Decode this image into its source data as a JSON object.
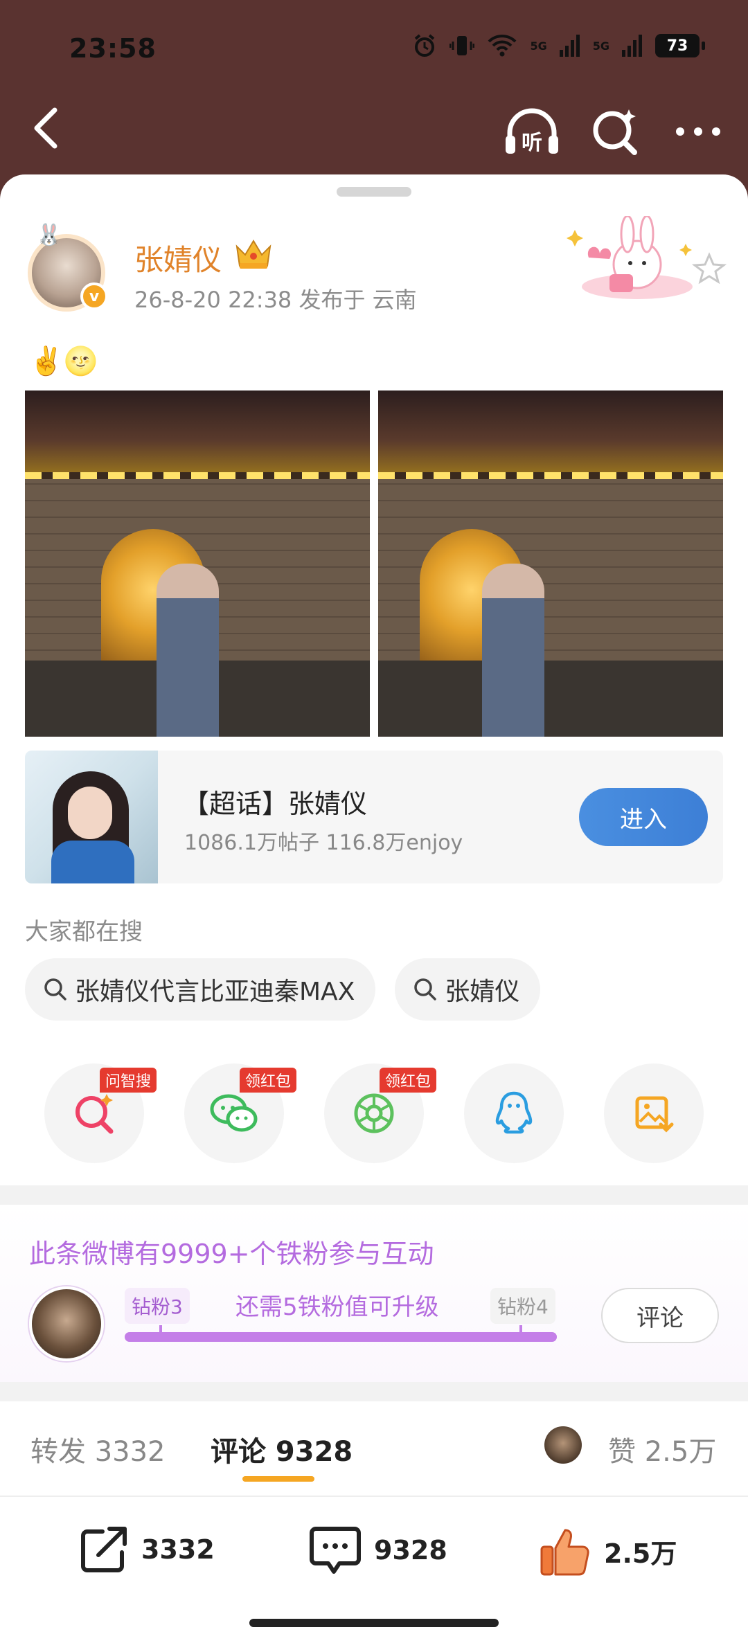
{
  "status_bar": {
    "time": "23:58",
    "signal1_label": "5G",
    "signal2_label": "5G",
    "battery": "73",
    "icons": [
      "alarm-icon",
      "vibrate-icon",
      "wifi-icon",
      "signal-icon",
      "signal-icon",
      "battery-icon"
    ]
  },
  "nav": {
    "back_icon": "chevron-left-icon",
    "listen_label": "听",
    "search_icon": "ai-search-icon",
    "more_icon": "more-icon"
  },
  "post": {
    "author": "张婧仪",
    "meta": "26-8-20 22:38   发布于 云南",
    "avatar_badge": "v",
    "emoji": "✌️🌝",
    "photos_count": 2
  },
  "super_topic": {
    "title": "【超话】张婧仪",
    "stats": "1086.1万帖子 116.8万enjoy",
    "enter_label": "进入"
  },
  "search": {
    "label": "大家都在搜",
    "chips": [
      "张婧仪代言比亚迪秦MAX",
      "张婧仪"
    ]
  },
  "share": {
    "items": [
      {
        "name": "ai-search",
        "tag": "问智搜",
        "icon": "ai-search-icon"
      },
      {
        "name": "wechat",
        "tag": "领红包",
        "icon": "wechat-icon"
      },
      {
        "name": "moments",
        "tag": "领红包",
        "icon": "moments-icon"
      },
      {
        "name": "qq",
        "tag": "",
        "icon": "qq-icon"
      },
      {
        "name": "save-image",
        "tag": "",
        "icon": "save-image-icon"
      }
    ]
  },
  "fans": {
    "title": "此条微博有9999+个铁粉参与互动",
    "level_from": "钻粉3",
    "level_hint": "还需5铁粉值可升级",
    "level_to": "钻粉4",
    "progress": 0.07,
    "comment_label": "评论"
  },
  "tabs": {
    "repost": "转发 3332",
    "comments": "评论 9328",
    "likes": "赞 2.5万"
  },
  "actions": {
    "repost_count": "3332",
    "comment_count": "9328",
    "like_count": "2.5万"
  },
  "colors": {
    "accent_orange": "#f5a623",
    "name_orange": "#e0832a",
    "fans_purple": "#b46bdf",
    "enter_blue": "#3d7fd6",
    "like_orange": "#f07a3a"
  }
}
